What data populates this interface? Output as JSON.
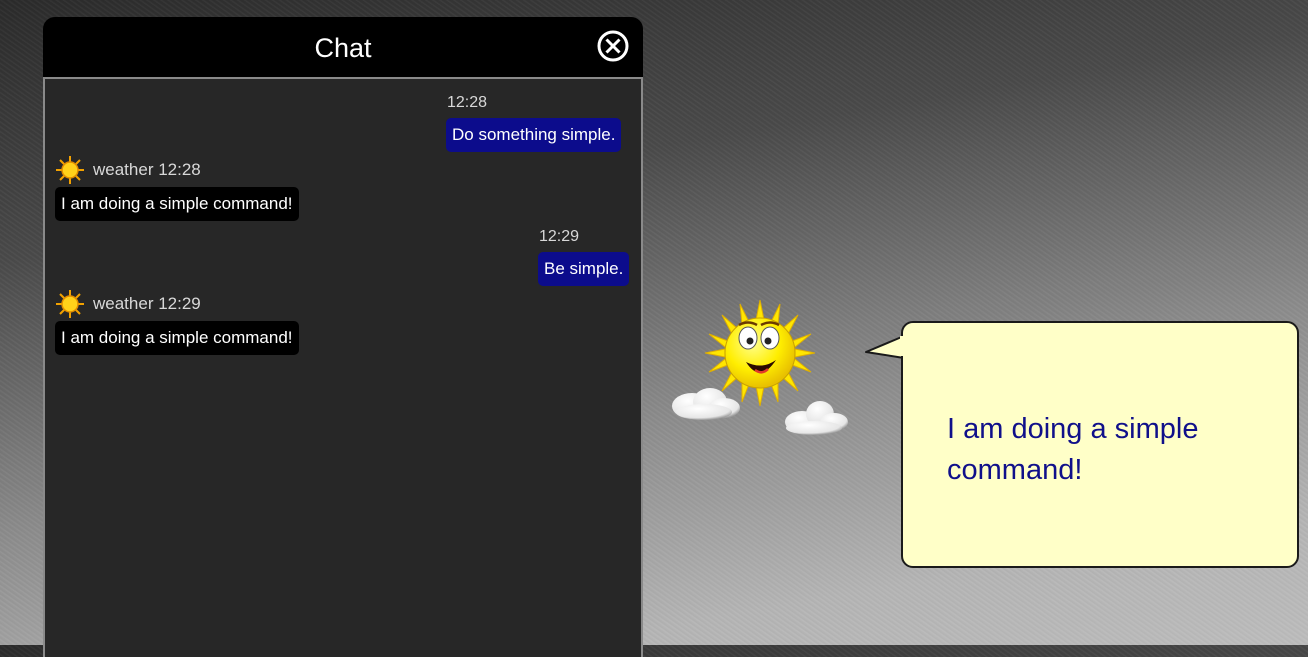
{
  "chat": {
    "title": "Chat",
    "close_icon": "circle-x-icon",
    "messages": [
      {
        "from": "user",
        "time": "12:28",
        "text": "Do something simple."
      },
      {
        "from": "bot",
        "icon": "sun-icon",
        "meta": "weather 12:28",
        "text": "I am doing a simple command!"
      },
      {
        "from": "user",
        "time": "12:29",
        "text": "Be simple."
      },
      {
        "from": "bot",
        "icon": "sun-icon",
        "meta": "weather 12:29",
        "text": "I am doing a simple command!"
      }
    ]
  },
  "agent": {
    "character": "smiling-sun-with-clouds",
    "speech": "I am doing a simple command!"
  },
  "colors": {
    "user_bubble": "#0c0c8c",
    "bot_bubble": "#000000",
    "speech_bg": "#ffffc8",
    "speech_text": "#10108a"
  }
}
